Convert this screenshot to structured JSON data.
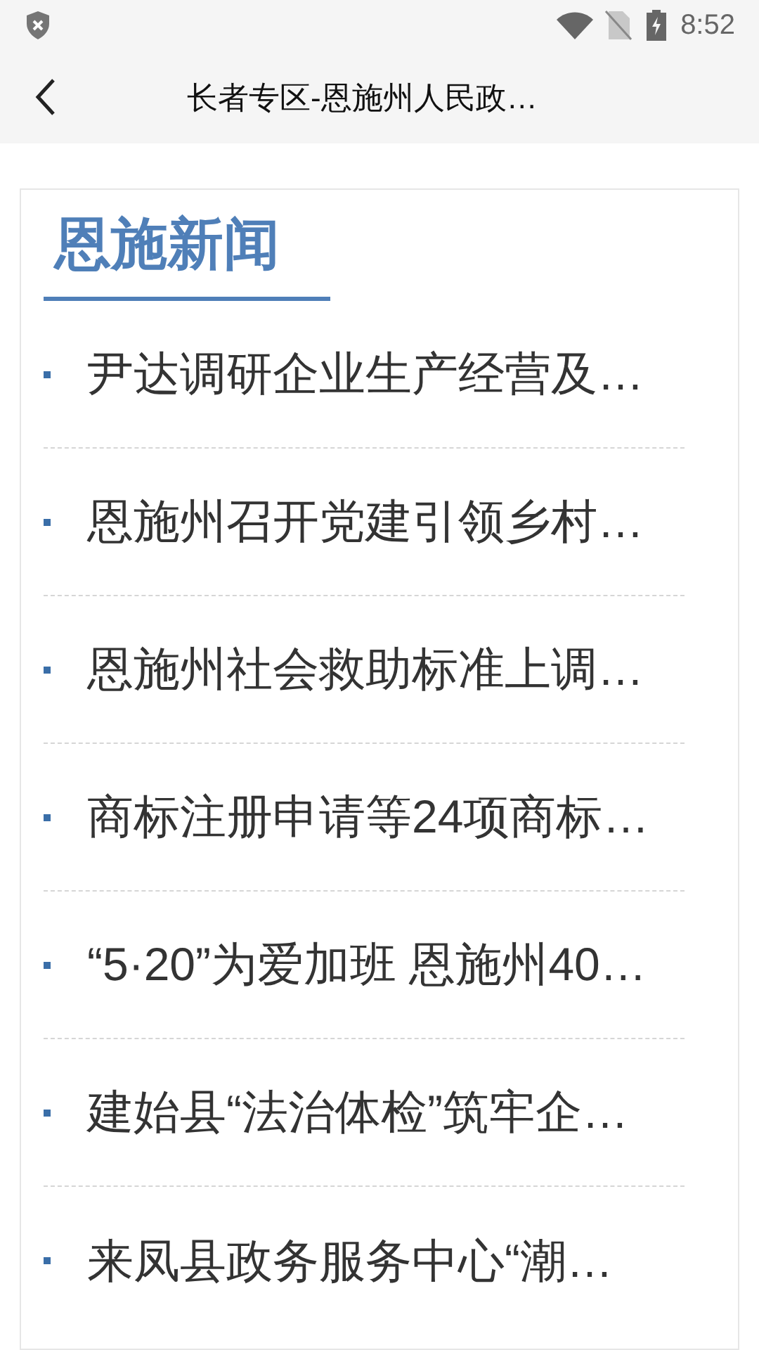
{
  "status_bar": {
    "time": "8:52"
  },
  "toolbar": {
    "title": "长者专区-恩施州人民政…"
  },
  "section": {
    "title": "恩施新闻",
    "items": [
      {
        "title": "尹达调研企业生产经营及…"
      },
      {
        "title": "恩施州召开党建引领乡村…"
      },
      {
        "title": "恩施州社会救助标准上调…"
      },
      {
        "title": "商标注册申请等24项商标…"
      },
      {
        "title": "“5·20”为爱加班 恩施州40…"
      },
      {
        "title": "建始县“法治体检”筑牢企…"
      },
      {
        "title": "来凤县政务服务中心“潮…"
      }
    ]
  }
}
